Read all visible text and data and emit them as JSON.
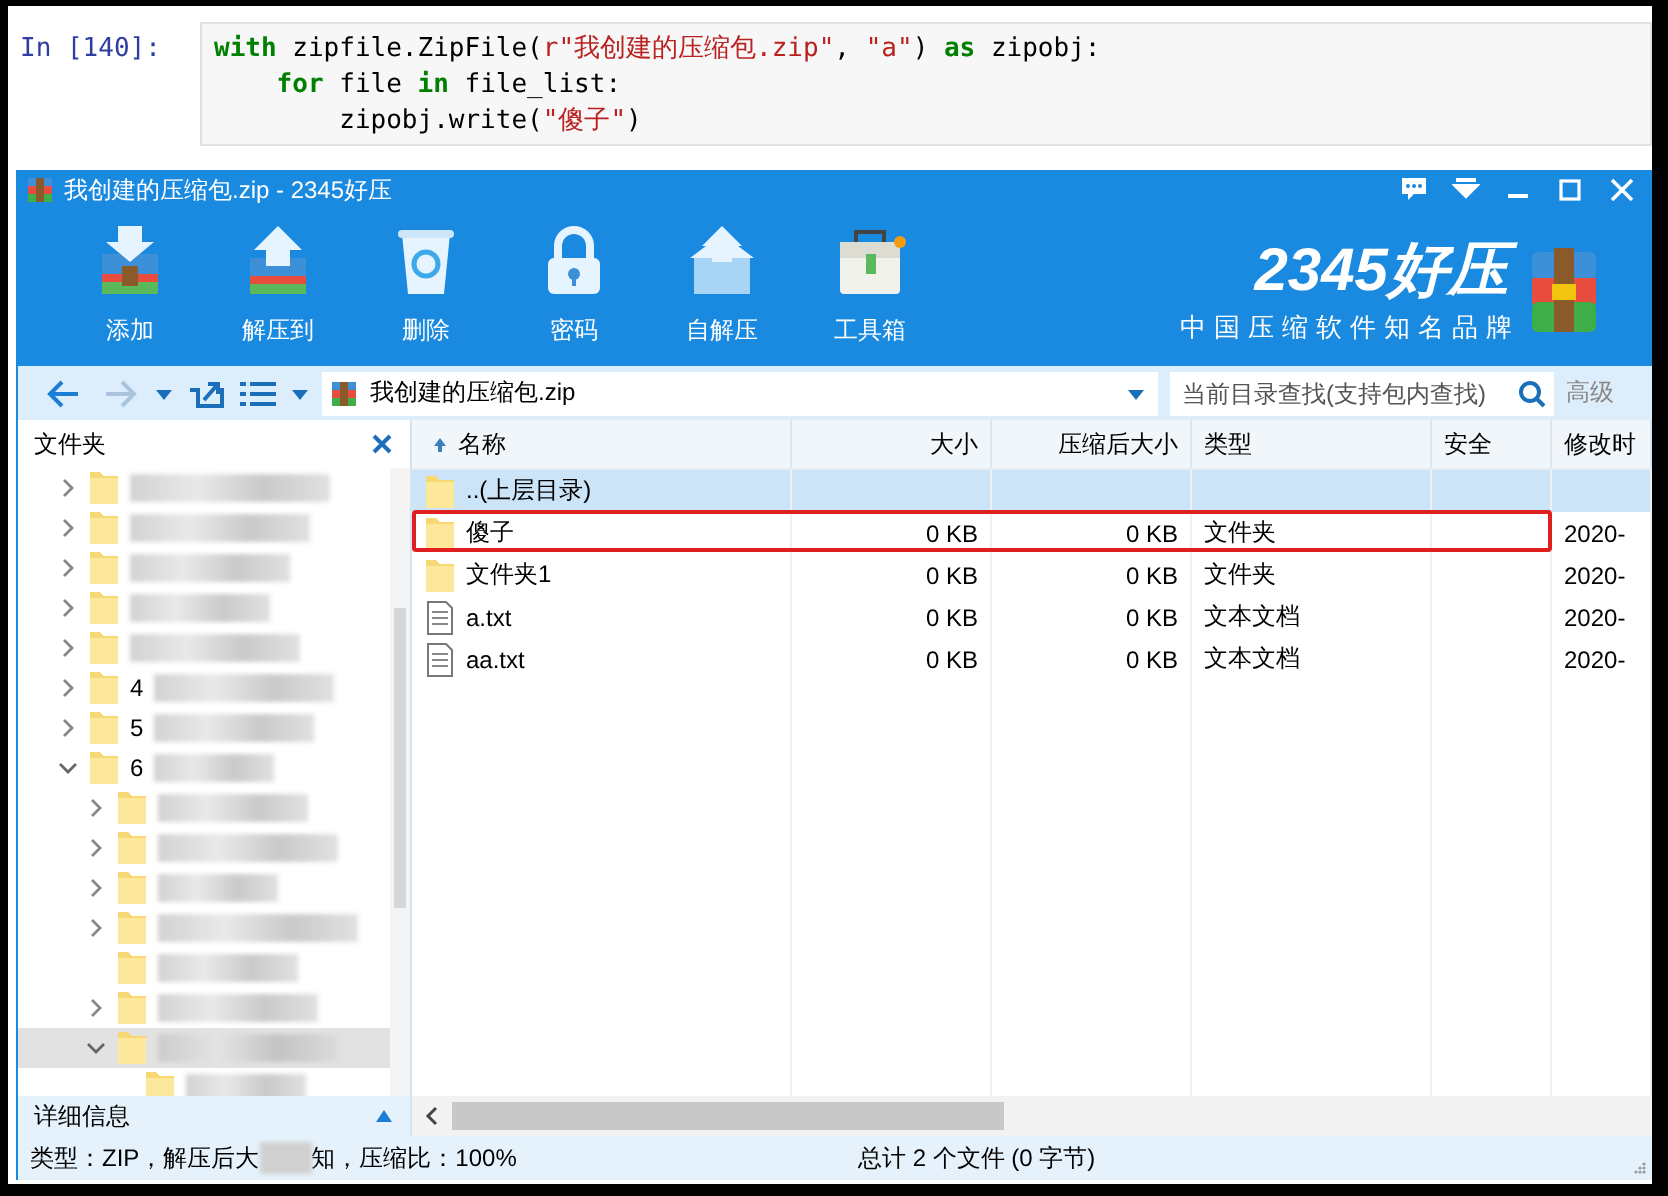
{
  "notebook": {
    "prompt": "In [140]:",
    "lines": [
      [
        {
          "kind": "kw",
          "text": "with"
        },
        {
          "kind": "plain",
          "text": " zipfile.ZipFile("
        },
        {
          "kind": "str",
          "text": "r\"我创建的压缩包.zip\""
        },
        {
          "kind": "plain",
          "text": ", "
        },
        {
          "kind": "str",
          "text": "\"a\""
        },
        {
          "kind": "plain",
          "text": ") "
        },
        {
          "kind": "kw",
          "text": "as"
        },
        {
          "kind": "plain",
          "text": " zipobj:"
        }
      ],
      [
        {
          "kind": "kw",
          "text": "    for"
        },
        {
          "kind": "plain",
          "text": " file "
        },
        {
          "kind": "kw",
          "text": "in"
        },
        {
          "kind": "plain",
          "text": " file_list:"
        }
      ],
      [
        {
          "kind": "plain",
          "text": "        zipobj.write("
        },
        {
          "kind": "str",
          "text": "\"傻子\""
        },
        {
          "kind": "plain",
          "text": ")"
        }
      ]
    ]
  },
  "window": {
    "title": "我创建的压缩包.zip - 2345好压",
    "controls": [
      {
        "kind": "feedback"
      },
      {
        "kind": "menu"
      },
      {
        "kind": "minimize"
      },
      {
        "kind": "maximize"
      },
      {
        "kind": "close"
      }
    ]
  },
  "toolbar": [
    {
      "label": "添加"
    },
    {
      "label": "解压到"
    },
    {
      "label": "删除"
    },
    {
      "label": "密码"
    },
    {
      "label": "自解压"
    },
    {
      "label": "工具箱"
    }
  ],
  "brand": {
    "name": "2345好压",
    "slogan": "中国压缩软件知名品牌"
  },
  "nav": {
    "back_disabled": false,
    "forward_disabled": true
  },
  "address": {
    "value": "我创建的压缩包.zip"
  },
  "search": {
    "placeholder": "当前目录查找(支持包内查找)",
    "advanced": "高级"
  },
  "folder_panel": {
    "title": "文件夹",
    "tree": [
      {
        "kind": "branch",
        "expanded": false,
        "selected": false
      },
      {
        "kind": "branch",
        "expanded": false,
        "selected": false
      },
      {
        "kind": "branch",
        "expanded": false,
        "selected": false
      },
      {
        "kind": "branch",
        "expanded": false,
        "selected": false
      },
      {
        "kind": "branch",
        "expanded": false,
        "selected": false
      },
      {
        "kind": "branch",
        "label": "4",
        "expanded": false,
        "selected": false
      },
      {
        "kind": "branch",
        "label": "5",
        "expanded": false,
        "selected": false
      },
      {
        "kind": "branch",
        "label": "6",
        "expanded": true,
        "selected": false,
        "children": [
          {
            "kind": "branch",
            "expanded": false,
            "selected": false
          },
          {
            "kind": "branch",
            "expanded": false,
            "selected": false
          },
          {
            "kind": "branch",
            "expanded": false,
            "selected": false
          },
          {
            "kind": "branch",
            "expanded": false,
            "selected": false
          },
          {
            "kind": "leaf",
            "selected": false
          },
          {
            "kind": "branch",
            "expanded": false,
            "selected": false
          },
          {
            "kind": "branch",
            "expanded": true,
            "selected": true,
            "children": [
              {
                "kind": "leaf",
                "selected": false
              }
            ]
          }
        ]
      }
    ]
  },
  "details": {
    "label": "详细信息",
    "expanded": false
  },
  "file_list": {
    "columns": [
      {
        "label": "名称",
        "sorted": true
      },
      {
        "label": "大小",
        "sorted": false
      },
      {
        "label": "压缩后大小",
        "sorted": false
      },
      {
        "label": "类型",
        "sorted": false
      },
      {
        "label": "安全",
        "sorted": false
      },
      {
        "label": "修改时",
        "sorted": false
      }
    ],
    "rows": [
      {
        "kind": "folder",
        "name": "..(上层目录)",
        "selected": true,
        "annotated": false
      },
      {
        "kind": "folder",
        "name": "傻子",
        "size": "0 KB",
        "packed": "0 KB",
        "type": "文件夹",
        "modified": "2020-",
        "selected": false,
        "annotated": true
      },
      {
        "kind": "folder",
        "name": "文件夹1",
        "size": "0 KB",
        "packed": "0 KB",
        "type": "文件夹",
        "modified": "2020-",
        "selected": false,
        "annotated": false
      },
      {
        "kind": "text",
        "name": "a.txt",
        "size": "0 KB",
        "packed": "0 KB",
        "type": "文本文档",
        "modified": "2020-",
        "selected": false,
        "annotated": false
      },
      {
        "kind": "text",
        "name": "aa.txt",
        "size": "0 KB",
        "packed": "0 KB",
        "type": "文本文档",
        "modified": "2020-",
        "selected": false,
        "annotated": false
      }
    ]
  },
  "status_bar": {
    "info_parts": [
      "类型：ZIP，解压后大",
      "知，压缩比：100%"
    ],
    "summary": "总计 2 个文件 (0 字节)"
  }
}
